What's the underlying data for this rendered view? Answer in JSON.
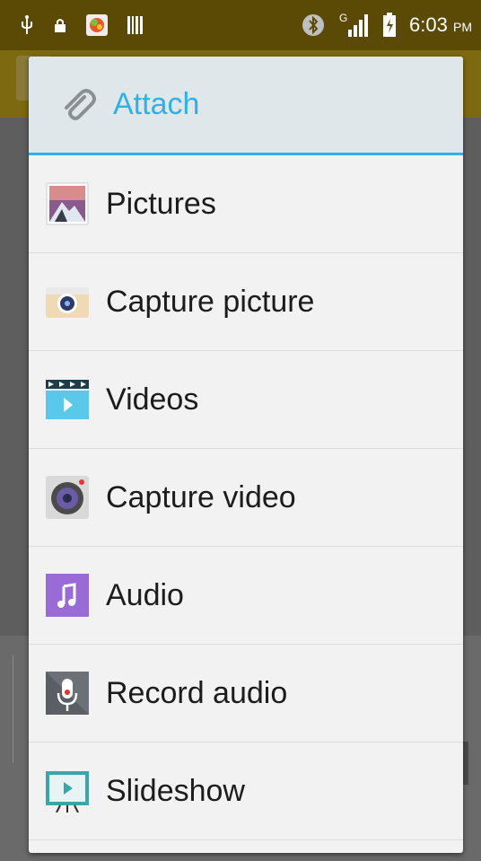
{
  "status_bar": {
    "time": "6:03",
    "ampm": "PM",
    "network": "G",
    "icons": [
      "usb-icon",
      "lock-icon",
      "app-icon",
      "barcode-icon",
      "bluetooth-icon",
      "signal-icon",
      "battery-icon"
    ]
  },
  "dialog": {
    "title": "Attach",
    "title_icon": "paperclip-icon",
    "accent_color": "#2fb0e6",
    "items": [
      {
        "label": "Pictures",
        "icon": "pictures-icon"
      },
      {
        "label": "Capture picture",
        "icon": "camera-icon"
      },
      {
        "label": "Videos",
        "icon": "video-icon"
      },
      {
        "label": "Capture video",
        "icon": "video-camera-icon"
      },
      {
        "label": "Audio",
        "icon": "music-note-icon"
      },
      {
        "label": "Record audio",
        "icon": "microphone-icon"
      },
      {
        "label": "Slideshow",
        "icon": "slideshow-icon"
      }
    ]
  }
}
